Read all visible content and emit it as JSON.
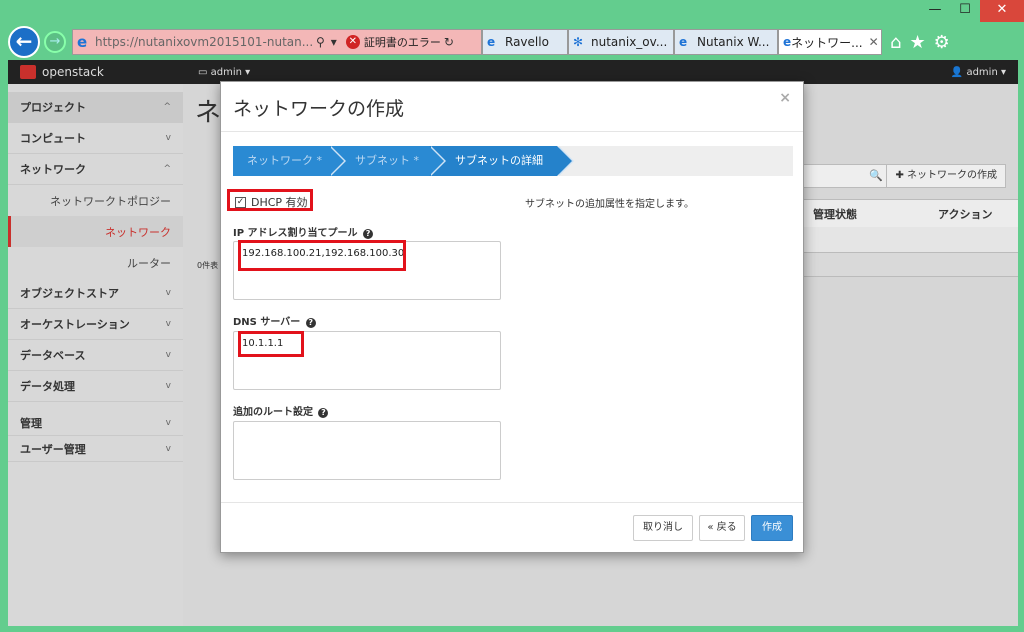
{
  "window": {
    "minimize": "—",
    "maximize": "☐",
    "close": "✕"
  },
  "browser": {
    "url": "https://nutanixovm2015101-nutan...",
    "search_icon": "⚲",
    "dropdown_icon": "▾",
    "cert_error": "証明書のエラー",
    "refresh_icon": "↻",
    "tabs": [
      {
        "label": "Ravello",
        "icon": "e"
      },
      {
        "label": "nutanix_ov...",
        "icon": "✻"
      },
      {
        "label": "Nutanix W...",
        "icon": "e"
      },
      {
        "label": "ネットワー...",
        "icon": "e",
        "active": true
      }
    ],
    "tab_close": "✕",
    "toolbar_icons": [
      "⌂",
      "★",
      "⚙"
    ]
  },
  "header": {
    "logo_text": "openstack",
    "project_menu": "▭ admin ▾",
    "user_menu": "👤 admin ▾"
  },
  "sidebar": {
    "items": [
      {
        "label": "プロジェクト",
        "chev": "^"
      },
      {
        "label": "コンピュート",
        "chev": "v"
      },
      {
        "label": "ネットワーク",
        "chev": "^"
      }
    ],
    "subitems": [
      {
        "label": "ネットワークトポロジー"
      },
      {
        "label": "ネットワーク"
      },
      {
        "label": "ルーター"
      }
    ],
    "more_items": [
      {
        "label": "オブジェクトストア",
        "chev": "v"
      },
      {
        "label": "オーケストレーション",
        "chev": "v"
      },
      {
        "label": "データベース",
        "chev": "v"
      },
      {
        "label": "データ処理",
        "chev": "v"
      }
    ],
    "admin_items": [
      {
        "label": "管理",
        "chev": "v"
      },
      {
        "label": "ユーザー管理",
        "chev": "v"
      }
    ]
  },
  "main": {
    "title": "ネ",
    "search_icon": "🔍",
    "create_button": "✚ ネットワークの作成",
    "col_admin_state": "管理状態",
    "col_action": "アクション",
    "count": "0件表"
  },
  "modal": {
    "title": "ネットワークの作成",
    "close": "×",
    "steps": [
      "ネットワーク *",
      "サブネット *",
      "サブネットの詳細"
    ],
    "dhcp_checked": "✓",
    "dhcp_label": "DHCP 有効",
    "help_text": "サブネットの追加属性を指定します。",
    "pool_label": "IP アドレス割り当てプール",
    "pool_value": "192.168.100.21,192.168.100.30",
    "dns_label": "DNS サーバー",
    "dns_value": "10.1.1.1",
    "route_label": "追加のルート設定",
    "route_value": "",
    "help_icon": "?",
    "cancel_button": "取り消し",
    "back_button": "« 戻る",
    "create_button": "作成"
  },
  "colors": {
    "highlight": "#e2121b",
    "primary": "#3a8fd6",
    "step": "#2a8ad3"
  }
}
